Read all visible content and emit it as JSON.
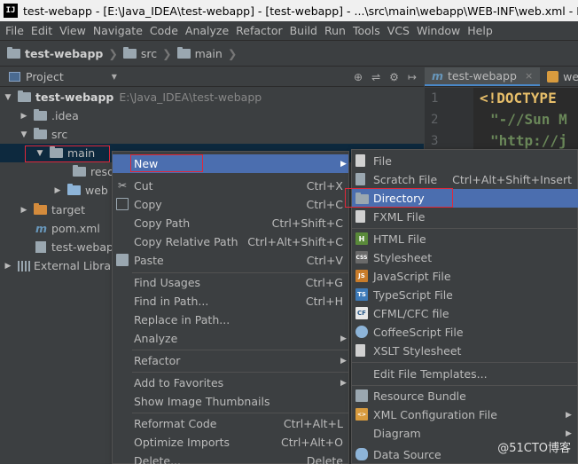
{
  "window": {
    "app_icon": "IJ",
    "title": "test-webapp - [E:\\Java_IDEA\\test-webapp] - [test-webapp] - ...\\src\\main\\webapp\\WEB-INF\\web.xml - IntelliJ"
  },
  "menubar": [
    "File",
    "Edit",
    "View",
    "Navigate",
    "Code",
    "Analyze",
    "Refactor",
    "Build",
    "Run",
    "Tools",
    "VCS",
    "Window",
    "Help"
  ],
  "breadcrumb": [
    "test-webapp",
    "src",
    "main"
  ],
  "project_panel": {
    "title": "Project",
    "tools": [
      "⊕",
      "⇌",
      "⚙",
      "↦"
    ],
    "tree": [
      {
        "label": "test-webapp",
        "path": "E:\\Java_IDEA\\test-webapp"
      },
      {
        "label": ".idea"
      },
      {
        "label": "src"
      },
      {
        "label": "main"
      },
      {
        "label": "reso"
      },
      {
        "label": "web"
      },
      {
        "label": "target"
      },
      {
        "label": "pom.xml"
      },
      {
        "label": "test-webap"
      },
      {
        "label": "External Librar"
      }
    ]
  },
  "editor": {
    "tabs": [
      {
        "label": "test-webapp",
        "close": "×"
      },
      {
        "label": "web"
      }
    ],
    "line_numbers": [
      "1",
      "2",
      "3"
    ],
    "lines": [
      "<!DOCTYPE",
      "\"-//Sun M",
      "\"http://j"
    ]
  },
  "context_menu": {
    "items": [
      {
        "label": "New",
        "shortcut": ""
      },
      {
        "label": "Cut",
        "shortcut": "Ctrl+X"
      },
      {
        "label": "Copy",
        "shortcut": "Ctrl+C"
      },
      {
        "label": "Copy Path",
        "shortcut": "Ctrl+Shift+C"
      },
      {
        "label": "Copy Relative Path",
        "shortcut": "Ctrl+Alt+Shift+C"
      },
      {
        "label": "Paste",
        "shortcut": "Ctrl+V"
      },
      {
        "label": "Find Usages",
        "shortcut": "Ctrl+G"
      },
      {
        "label": "Find in Path...",
        "shortcut": "Ctrl+H"
      },
      {
        "label": "Replace in Path...",
        "shortcut": ""
      },
      {
        "label": "Analyze",
        "shortcut": ""
      },
      {
        "label": "Refactor",
        "shortcut": ""
      },
      {
        "label": "Add to Favorites",
        "shortcut": ""
      },
      {
        "label": "Show Image Thumbnails",
        "shortcut": ""
      },
      {
        "label": "Reformat Code",
        "shortcut": "Ctrl+Alt+L"
      },
      {
        "label": "Optimize Imports",
        "shortcut": "Ctrl+Alt+O"
      },
      {
        "label": "Delete...",
        "shortcut": "Delete"
      }
    ]
  },
  "new_submenu": {
    "items": [
      {
        "label": "File",
        "shortcut": ""
      },
      {
        "label": "Scratch File",
        "shortcut": "Ctrl+Alt+Shift+Insert"
      },
      {
        "label": "Directory",
        "shortcut": ""
      },
      {
        "label": "FXML File",
        "shortcut": ""
      },
      {
        "label": "HTML File",
        "shortcut": ""
      },
      {
        "label": "Stylesheet",
        "shortcut": ""
      },
      {
        "label": "JavaScript File",
        "shortcut": ""
      },
      {
        "label": "TypeScript File",
        "shortcut": ""
      },
      {
        "label": "CFML/CFC file",
        "shortcut": ""
      },
      {
        "label": "CoffeeScript File",
        "shortcut": ""
      },
      {
        "label": "XSLT Stylesheet",
        "shortcut": ""
      },
      {
        "label": "Edit File Templates...",
        "shortcut": ""
      },
      {
        "label": "Resource Bundle",
        "shortcut": ""
      },
      {
        "label": "XML Configuration File",
        "shortcut": ""
      },
      {
        "label": "Diagram",
        "shortcut": ""
      },
      {
        "label": "Data Source",
        "shortcut": ""
      }
    ]
  },
  "icon_labels": {
    "html": "H",
    "css": "CSS",
    "js": "JS",
    "ts": "TS",
    "cf": "CF",
    "xml": "<>"
  },
  "watermark": "@51CTO博客",
  "colors": {
    "highlight": "#4b6eaf",
    "annotation_box": "#e0283a",
    "background": "#3c3f41",
    "editor_bg": "#2b2b2b"
  }
}
